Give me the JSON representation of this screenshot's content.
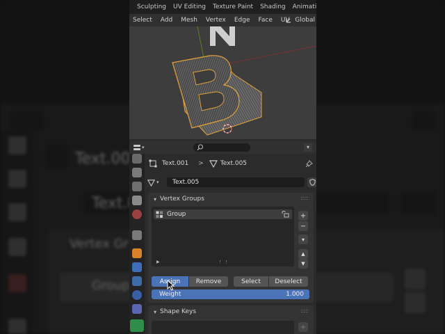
{
  "workspace_tabs": [
    "Sculpting",
    "UV Editing",
    "Texture Paint",
    "Shading",
    "Animation"
  ],
  "menu": {
    "items": [
      "Select",
      "Add",
      "Mesh",
      "Vertex",
      "Edge",
      "Face",
      "UV"
    ],
    "transform_orientation": "Global"
  },
  "viewport": {
    "object_letter": "B"
  },
  "breadcrumb": {
    "object_name": "Text.001",
    "separator": ">",
    "mesh_name": "Text.005"
  },
  "datablock": {
    "name": "Text.005"
  },
  "vertex_groups": {
    "title": "Vertex Groups",
    "items": [
      {
        "name": "Group"
      }
    ],
    "buttons": {
      "assign": "Assign",
      "remove": "Remove",
      "select": "Select",
      "deselect": "Deselect"
    },
    "weight_label": "Weight",
    "weight_value": "1.000"
  },
  "shape_keys": {
    "title": "Shape Keys"
  },
  "background": {
    "object_name": "Text.001",
    "mesh_name": "Text.0",
    "panel_title": "Vertex Gr",
    "group_name": "Group"
  },
  "colors": {
    "accent_blue": "#4b74b8",
    "selection_orange": "#e8a33a",
    "panel_bg": "#333333"
  }
}
